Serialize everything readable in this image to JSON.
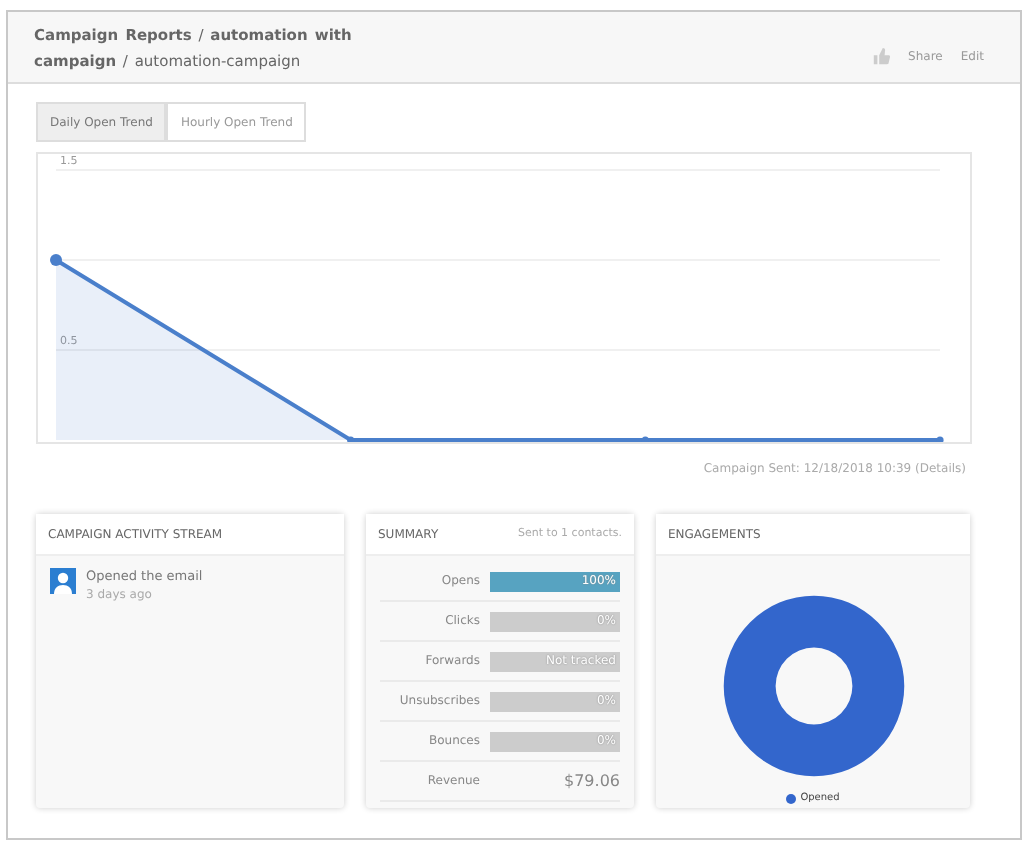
{
  "header": {
    "breadcrumb": "**Campaign Reports** / **automation with campaign** / automation-campaign",
    "actions": [
      "Share",
      "Edit"
    ]
  },
  "tabs": [
    {
      "label": "Daily Open Trend",
      "selected": true
    },
    {
      "label": "Hourly Open Trend",
      "selected": false
    }
  ],
  "trend": {
    "chart_data": {
      "type": "area",
      "series": [
        {
          "color": "#4a7fcb",
          "values": [
            1,
            0,
            0,
            0
          ]
        }
      ],
      "ylim": [
        0,
        1.5
      ],
      "yticks": [
        0.5,
        1.5
      ]
    }
  },
  "sent_note": "Campaign Sent: 12/18/2018 10:39 (Details)",
  "activity": {
    "title": "CAMPAIGN ACTIVITY STREAM",
    "items": [
      {
        "text": "Opened the email",
        "time": "3 days ago"
      }
    ]
  },
  "summary": {
    "title": "SUMMARY",
    "note": "Sent to 1 contacts.",
    "rows": [
      {
        "kind": "bar",
        "label": "Opens",
        "value": "100%",
        "level": 1
      },
      {
        "kind": "bar",
        "label": "Clicks",
        "value": "0%",
        "level": 0
      },
      {
        "kind": "bar",
        "label": "Forwards",
        "value": "Not tracked",
        "level": 0
      },
      {
        "kind": "bar",
        "label": "Unsubscribes",
        "value": "0%",
        "level": 0
      },
      {
        "kind": "bar",
        "label": "Bounces",
        "value": "0%",
        "level": 0
      },
      {
        "kind": "text",
        "label": "Revenue",
        "value": "$79.06"
      }
    ]
  },
  "engagements": {
    "title": "ENGAGEMENTS",
    "legend": [
      {
        "label": "Opened",
        "color": "#3366cc"
      }
    ]
  }
}
